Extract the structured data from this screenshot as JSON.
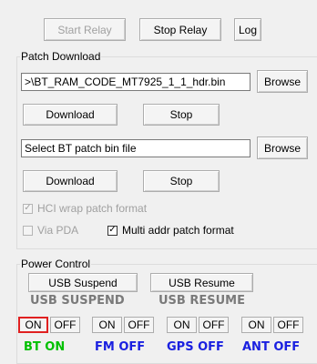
{
  "top_buttons": {
    "start_relay": "Start Relay",
    "stop_relay": "Stop Relay",
    "log": "Log"
  },
  "patch_download": {
    "title": "Patch Download",
    "file1": {
      "value": ">\\BT_RAM_CODE_MT7925_1_1_hdr.bin",
      "browse": "Browse",
      "download": "Download",
      "stop": "Stop"
    },
    "file2": {
      "placeholder": "Select BT patch bin file",
      "browse": "Browse",
      "download": "Download",
      "stop": "Stop"
    },
    "options": {
      "hci_wrap": {
        "label": "HCI wrap patch format",
        "checked": true,
        "enabled": false
      },
      "via_pda": {
        "label": "Via PDA",
        "checked": false,
        "enabled": false
      },
      "multi_addr": {
        "label": "Multi addr patch format",
        "checked": true,
        "enabled": true
      }
    }
  },
  "power_control": {
    "title": "Power Control",
    "usb_suspend_button": "USB Suspend",
    "usb_resume_button": "USB Resume",
    "usb_suspend_label": "USB SUSPEND",
    "usb_resume_label": "USB RESUME",
    "toggles": [
      {
        "on": "ON",
        "off": "OFF"
      },
      {
        "on": "ON",
        "off": "OFF"
      },
      {
        "on": "ON",
        "off": "OFF"
      },
      {
        "on": "ON",
        "off": "OFF"
      }
    ],
    "status": {
      "bt": "BT ON",
      "fm": "FM OFF",
      "gps": "GPS OFF",
      "ant": "ANT OFF"
    }
  },
  "colors": {
    "usb_label": "#7a7a7a",
    "bt_on": "#00c000",
    "off_status": "#1a20e0",
    "selected_border": "#e02020"
  }
}
